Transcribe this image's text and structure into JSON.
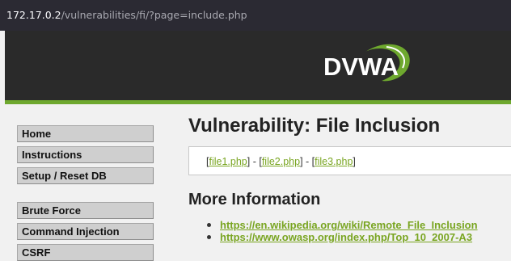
{
  "browser": {
    "url_host": "172.17.0.2",
    "url_path": "/vulnerabilities/fi/?page=include.php"
  },
  "header": {
    "logo_text": "DVWA",
    "colors": {
      "header_bg": "#2a2a2a",
      "accent_green": "#6ea82e"
    }
  },
  "menu": {
    "items": [
      {
        "label": "Home"
      },
      {
        "label": "Instructions"
      },
      {
        "label": "Setup / Reset DB"
      },
      {
        "label": "Brute Force"
      },
      {
        "label": "Command Injection"
      },
      {
        "label": "CSRF"
      }
    ]
  },
  "main": {
    "title": "Vulnerability: File Inclusion",
    "files": [
      {
        "label": "file1.php"
      },
      {
        "label": "file2.php"
      },
      {
        "label": "file3.php"
      }
    ],
    "more_info_title": "More Information",
    "links": [
      {
        "label": "https://en.wikipedia.org/wiki/Remote_File_Inclusion"
      },
      {
        "label": "https://www.owasp.org/index.php/Top_10_2007-A3"
      }
    ]
  }
}
